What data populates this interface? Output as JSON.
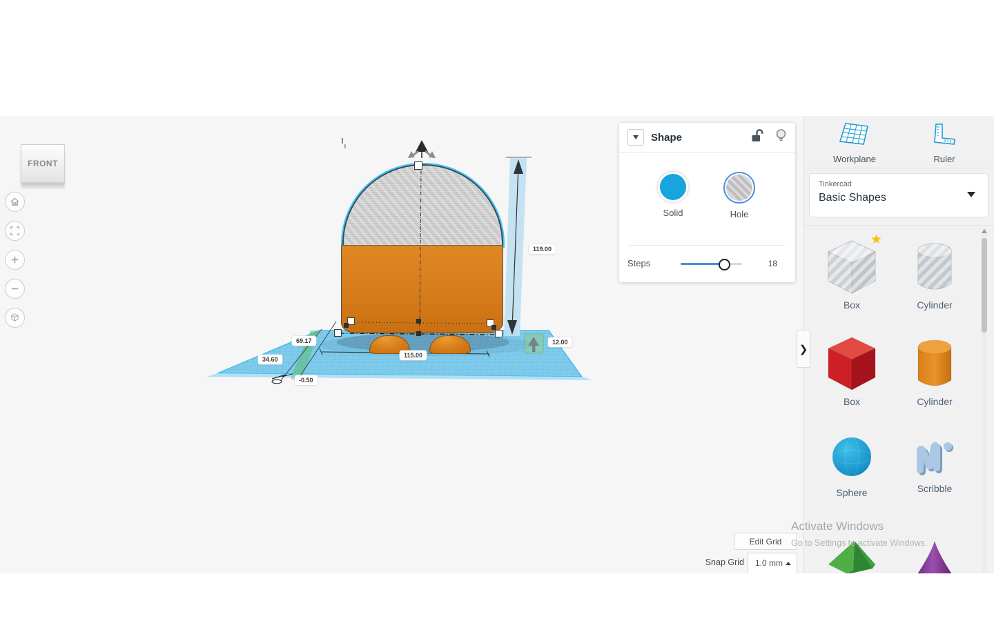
{
  "view_cube": {
    "label": "FRONT"
  },
  "shape_panel": {
    "title": "Shape",
    "materials": [
      {
        "label": "Solid",
        "selected": false
      },
      {
        "label": "Hole",
        "selected": true
      }
    ],
    "steps_label": "Steps",
    "steps_value": "18"
  },
  "scene": {
    "dimensions": {
      "height": "119.00",
      "elevation": "12.00",
      "width": "115.00",
      "offset_a": "69.17",
      "offset_b": "34.60",
      "offset_c": "-0.50"
    }
  },
  "sidebar": {
    "tools": [
      {
        "label": "Workplane"
      },
      {
        "label": "Ruler"
      }
    ],
    "library": {
      "brand": "Tinkercad",
      "name": "Basic Shapes"
    },
    "shapes": [
      {
        "label": "Box",
        "starred": true,
        "material": "hole"
      },
      {
        "label": "Cylinder",
        "material": "hole"
      },
      {
        "label": "Box",
        "material": "solid-red"
      },
      {
        "label": "Cylinder",
        "material": "solid-orange"
      },
      {
        "label": "Sphere",
        "material": "solid-blue"
      },
      {
        "label": "Scribble",
        "material": "solid-lightblue"
      }
    ]
  },
  "grid_controls": {
    "edit_grid": "Edit Grid",
    "snap_label": "Snap Grid",
    "snap_value": "1.0 mm"
  },
  "watermark": {
    "line1": "Activate Windows",
    "line2": "Go to Settings to activate Windows."
  },
  "colors": {
    "accent_blue": "#18a4dd",
    "hole_ring": "#5290d9",
    "model_orange": "#d57c1b",
    "workplane_blue": "#7ecbec",
    "selection_cyan": "#3dc8f3"
  }
}
